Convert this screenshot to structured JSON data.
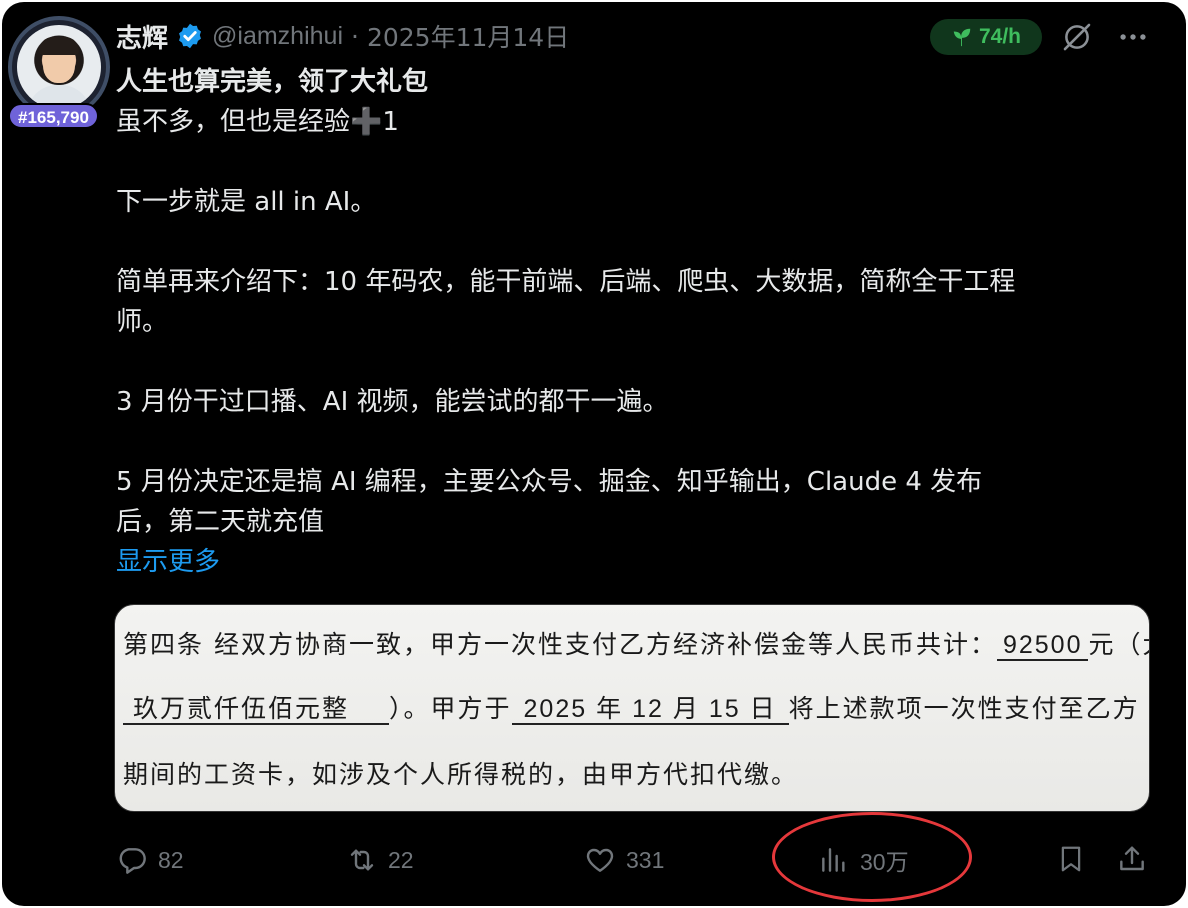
{
  "user": {
    "display_name": "志辉",
    "handle": "@iamzhihui",
    "separator": "·",
    "date": "2025年11月14日",
    "rank_badge": "#165,790",
    "verified_icon": "verified-badge-icon"
  },
  "top_bar": {
    "rate_label": "74/h",
    "rate_icon": "sprout-icon",
    "grok_icon": "grok-slash-icon",
    "more_icon": "more-dots-icon"
  },
  "post": {
    "lines": [
      "人生也算完美，领了大礼包",
      "虽不多，但也是经验➕1",
      "",
      "下一步就是 all in AI。",
      "",
      "简单再来介绍下：10 年码农，能干前端、后端、爬虫、大数据，简称全干工程",
      "师。",
      "",
      "3 月份干过口播、AI 视频，能尝试的都干一遍。",
      "",
      "5 月份决定还是搞 AI 编程，主要公众号、掘金、知乎输出，Claude 4 发布",
      "后，第二天就充值"
    ],
    "show_more": "显示更多"
  },
  "attachment": {
    "line1_prefix": "第四条   经双方协商一致，甲方一次性支付乙方经济补偿金等人民币共计：",
    "line1_amount": "92500",
    "line1_suffix": "元（大",
    "line2_amount_words": "玖万贰仟伍佰元整",
    "line2_mid": "）。甲方于",
    "line2_year": "2025",
    "line2_year_unit": "年",
    "line2_month": "12",
    "line2_month_unit": "月",
    "line2_day": "15",
    "line2_day_unit": "日",
    "line2_suffix": "将上述款项一次性支付至乙方",
    "line3": "期间的工资卡，如涉及个人所得税的，由甲方代扣代缴。"
  },
  "actions": {
    "replies": "82",
    "reposts": "22",
    "likes": "331",
    "views": "30万"
  },
  "colors": {
    "background": "#000000",
    "text": "#e7e9ea",
    "muted": "#71767b",
    "link": "#1d9bf0",
    "rate_green": "#3fbd5e",
    "highlight_red": "#e5383b",
    "badge_purple": "#6f63d9"
  }
}
